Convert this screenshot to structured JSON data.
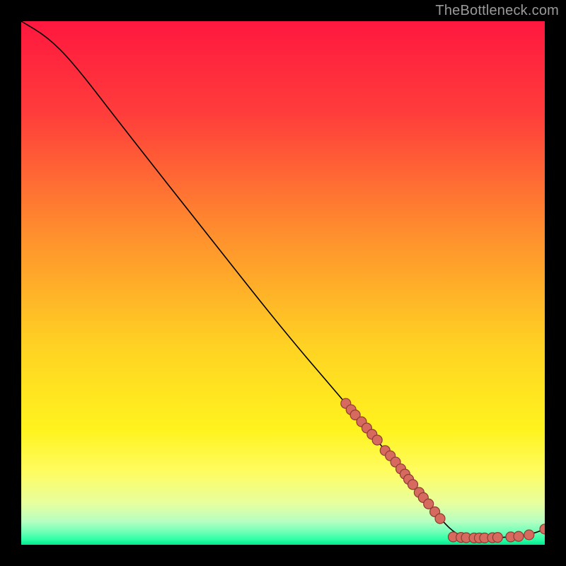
{
  "watermark": "TheBottleneck.com",
  "chart_data": {
    "type": "line",
    "title": "",
    "xlabel": "",
    "ylabel": "",
    "xlim": [
      0,
      100
    ],
    "ylim": [
      0,
      100
    ],
    "grid": false,
    "gradient_stops": [
      {
        "offset": 0.0,
        "color": "#ff173f"
      },
      {
        "offset": 0.18,
        "color": "#ff3e3b"
      },
      {
        "offset": 0.4,
        "color": "#ff8d2e"
      },
      {
        "offset": 0.62,
        "color": "#ffd223"
      },
      {
        "offset": 0.78,
        "color": "#fff31e"
      },
      {
        "offset": 0.86,
        "color": "#fffc60"
      },
      {
        "offset": 0.92,
        "color": "#e8ff9d"
      },
      {
        "offset": 0.955,
        "color": "#b6ffc2"
      },
      {
        "offset": 0.975,
        "color": "#71ffb7"
      },
      {
        "offset": 0.99,
        "color": "#2dffa6"
      },
      {
        "offset": 1.0,
        "color": "#00e890"
      }
    ],
    "curve": [
      {
        "x": 0,
        "y": 100
      },
      {
        "x": 5,
        "y": 97
      },
      {
        "x": 10,
        "y": 92
      },
      {
        "x": 20,
        "y": 79
      },
      {
        "x": 35,
        "y": 60
      },
      {
        "x": 50,
        "y": 41
      },
      {
        "x": 62,
        "y": 27
      },
      {
        "x": 70,
        "y": 17.5
      },
      {
        "x": 76,
        "y": 10
      },
      {
        "x": 80,
        "y": 5
      },
      {
        "x": 83,
        "y": 2
      },
      {
        "x": 86,
        "y": 1.3
      },
      {
        "x": 90,
        "y": 1.3
      },
      {
        "x": 95,
        "y": 1.6
      },
      {
        "x": 98,
        "y": 2.2
      },
      {
        "x": 100,
        "y": 3.0
      }
    ],
    "scatter": [
      {
        "x": 62,
        "y": 27.0
      },
      {
        "x": 63,
        "y": 25.8
      },
      {
        "x": 63.8,
        "y": 24.8
      },
      {
        "x": 65,
        "y": 23.5
      },
      {
        "x": 66,
        "y": 22.3
      },
      {
        "x": 67,
        "y": 21.1
      },
      {
        "x": 68,
        "y": 20.0
      },
      {
        "x": 69.5,
        "y": 18.0
      },
      {
        "x": 70.5,
        "y": 17.0
      },
      {
        "x": 71.5,
        "y": 15.8
      },
      {
        "x": 72.5,
        "y": 14.5
      },
      {
        "x": 73.3,
        "y": 13.5
      },
      {
        "x": 74.0,
        "y": 12.5
      },
      {
        "x": 74.8,
        "y": 11.5
      },
      {
        "x": 76.0,
        "y": 10.0
      },
      {
        "x": 76.8,
        "y": 9.0
      },
      {
        "x": 77.8,
        "y": 7.8
      },
      {
        "x": 79.0,
        "y": 6.3
      },
      {
        "x": 80.0,
        "y": 5.0
      },
      {
        "x": 82.5,
        "y": 1.5
      },
      {
        "x": 84.0,
        "y": 1.4
      },
      {
        "x": 85.0,
        "y": 1.35
      },
      {
        "x": 86.5,
        "y": 1.3
      },
      {
        "x": 87.5,
        "y": 1.3
      },
      {
        "x": 88.5,
        "y": 1.3
      },
      {
        "x": 90.0,
        "y": 1.35
      },
      {
        "x": 91.0,
        "y": 1.4
      },
      {
        "x": 93.5,
        "y": 1.5
      },
      {
        "x": 95.0,
        "y": 1.6
      },
      {
        "x": 97.0,
        "y": 1.9
      },
      {
        "x": 100.0,
        "y": 3.0
      }
    ],
    "marker": {
      "radius_px": 7,
      "fill": "#d66a5e",
      "stroke": "#8f3b33",
      "stroke_width": 1.2
    },
    "line_style": {
      "stroke": "#000000",
      "width": 1.6
    }
  }
}
